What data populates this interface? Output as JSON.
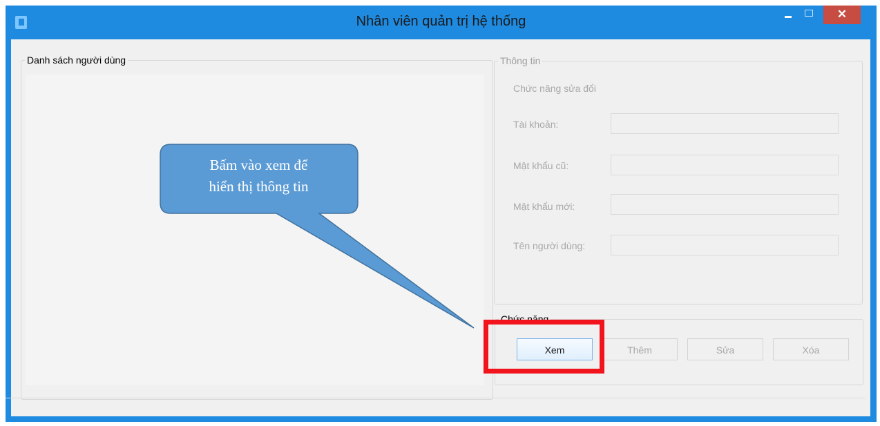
{
  "window": {
    "title": "Nhân viên quản trị hệ thống",
    "close_glyph": "✕",
    "title_bar_color": "#1e8ae0",
    "close_color": "#c74c41"
  },
  "users_panel": {
    "title": "Danh sách người dùng"
  },
  "info_panel": {
    "title": "Thông tin",
    "mode_label": "Chức năng sửa đổi",
    "fields": [
      {
        "label": "Tài khoản:",
        "value": ""
      },
      {
        "label": "Mật khẩu cũ:",
        "value": ""
      },
      {
        "label": "Mật khẩu mới:",
        "value": ""
      },
      {
        "label": "Tên người dùng:",
        "value": ""
      }
    ]
  },
  "functions_panel": {
    "title": "Chức năng",
    "buttons": {
      "view": "Xem",
      "add": "Thêm",
      "edit": "Sửa",
      "delete": "Xóa"
    }
  },
  "callout": {
    "line1": "Bấm vào xem để",
    "line2": "hiển thị thông tin",
    "fill_color": "#5b9bd5",
    "highlight_color": "#f2141c"
  }
}
